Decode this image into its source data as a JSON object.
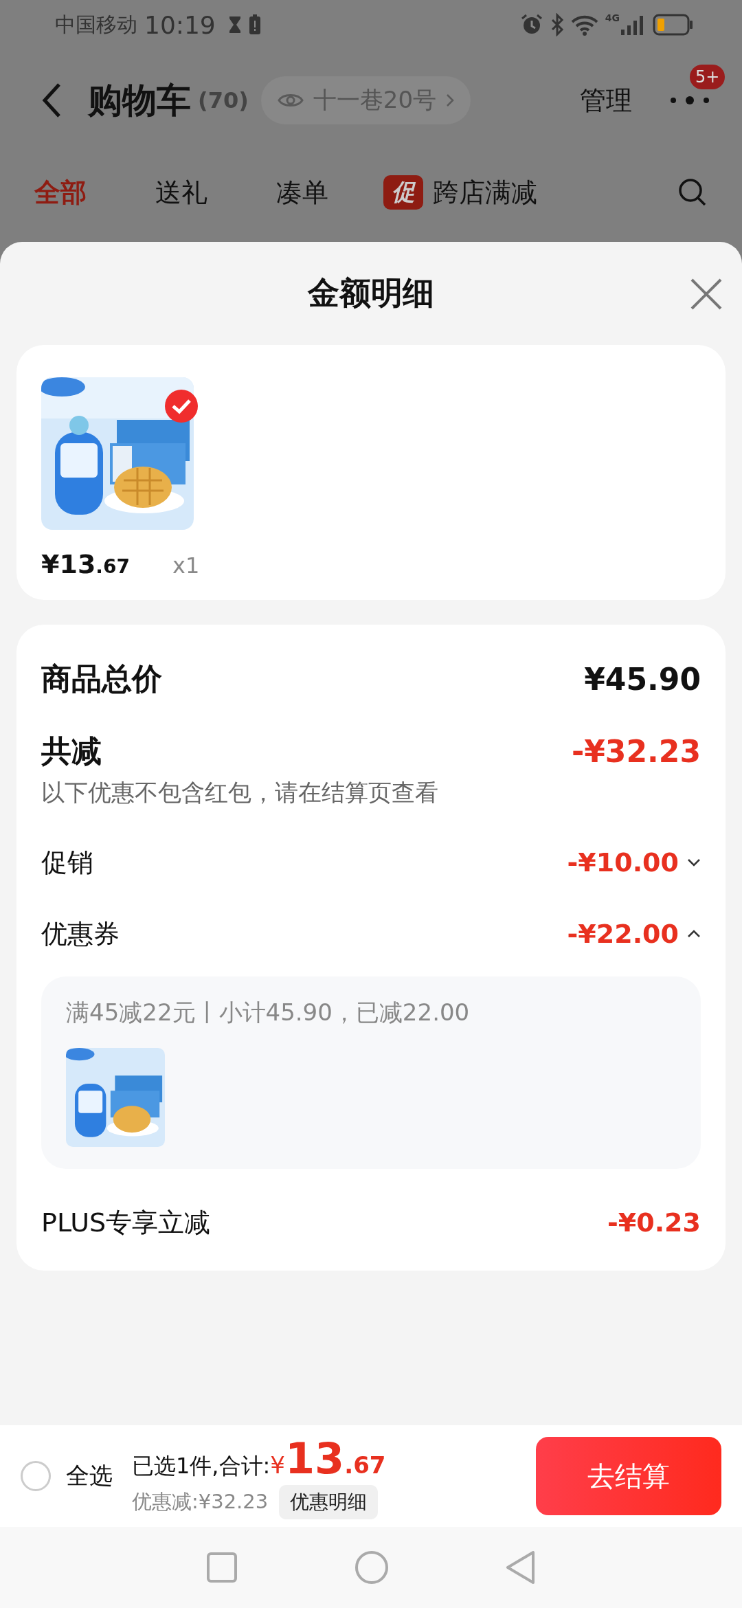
{
  "status_bar": {
    "carrier": "中国移动",
    "time": "10:19",
    "network": "4G"
  },
  "header": {
    "title": "购物车",
    "count": "(70)",
    "address": "十一巷20号",
    "manage": "管理",
    "badge": "5+"
  },
  "tabs": [
    {
      "label": "全部",
      "selected": true,
      "kind": "plain"
    },
    {
      "label": "送礼",
      "selected": false,
      "kind": "plain"
    },
    {
      "label": "凑单",
      "selected": false,
      "kind": "plain"
    },
    {
      "label": "跨店满减",
      "selected": false,
      "kind": "promo",
      "tag": "促"
    }
  ],
  "sheet": {
    "title": "金额明细"
  },
  "items": [
    {
      "checked": true,
      "price_main": "¥13",
      "price_decimal": ".67",
      "quantity": "x1"
    }
  ],
  "summary": {
    "total_label": "商品总价",
    "total_value": "¥45.90",
    "discount_label": "共减",
    "discount_value": "-¥32.23",
    "note": "以下优惠不包含红包，请在结算页查看"
  },
  "rows": [
    {
      "label": "促销",
      "value": "-¥10.00",
      "expanded": false
    },
    {
      "label": "优惠券",
      "value": "-¥22.00",
      "expanded": true
    },
    {
      "label": "PLUS专享立减",
      "value": "-¥0.23"
    }
  ],
  "coupon": {
    "text": "满45减22元丨小计45.90，已减22.00"
  },
  "footer": {
    "select_all": "全选",
    "select_all_checked": false,
    "selected_text": "已选1件,合计:",
    "currency": "¥",
    "amount_main": "13",
    "amount_decimal": ".67",
    "saving": "优惠减:¥32.23",
    "details_button": "优惠明细",
    "checkout": "去结算"
  }
}
